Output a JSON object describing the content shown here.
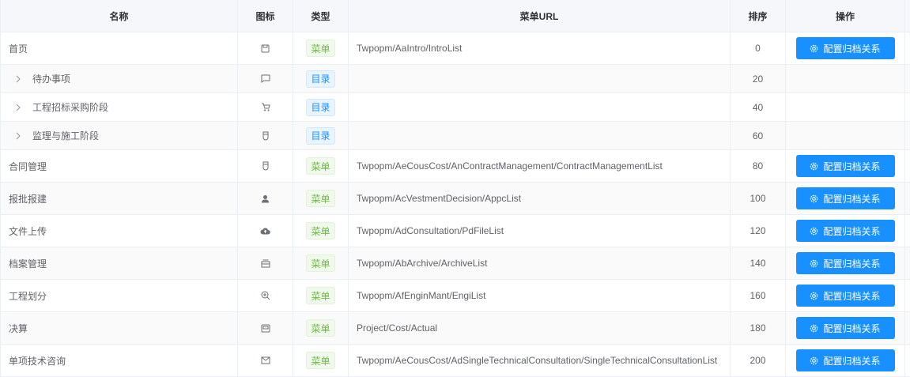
{
  "headers": {
    "name": "名称",
    "icon": "图标",
    "type": "类型",
    "url": "菜单URL",
    "order": "排序",
    "ops": "操作"
  },
  "action_label": "配置归档关系",
  "rows": [
    {
      "name": "首页",
      "icon": "save-icon",
      "type": "菜单",
      "url": "Twpopm/AaIntro/IntroList",
      "order": "0",
      "action": true,
      "child": false
    },
    {
      "name": "待办事项",
      "icon": "message-icon",
      "type": "目录",
      "url": "",
      "order": "20",
      "action": false,
      "child": true
    },
    {
      "name": "工程招标采购阶段",
      "icon": "cart-icon",
      "type": "目录",
      "url": "",
      "order": "40",
      "action": false,
      "child": true
    },
    {
      "name": "监理与施工阶段",
      "icon": "cup-icon",
      "type": "目录",
      "url": "",
      "order": "60",
      "action": false,
      "child": true
    },
    {
      "name": "合同管理",
      "icon": "cup-icon",
      "type": "菜单",
      "url": "Twpopm/AeCousCost/AnContractManagement/ContractManagementList",
      "order": "80",
      "action": true,
      "child": false
    },
    {
      "name": "报批报建",
      "icon": "user-icon",
      "type": "菜单",
      "url": "Twpopm/AcVestmentDecision/AppcList",
      "order": "100",
      "action": true,
      "child": false
    },
    {
      "name": "文件上传",
      "icon": "cloud-upload-icon",
      "type": "菜单",
      "url": "Twpopm/AdConsultation/PdFileList",
      "order": "120",
      "action": true,
      "child": false
    },
    {
      "name": "档案管理",
      "icon": "box-icon",
      "type": "菜单",
      "url": "Twpopm/AbArchive/ArchiveList",
      "order": "140",
      "action": true,
      "child": false
    },
    {
      "name": "工程划分",
      "icon": "zoom-in-icon",
      "type": "菜单",
      "url": "Twpopm/AfEnginMant/EngiList",
      "order": "160",
      "action": true,
      "child": false
    },
    {
      "name": "决算",
      "icon": "calc-icon",
      "type": "菜单",
      "url": "Project/Cost/Actual",
      "order": "180",
      "action": true,
      "child": false
    },
    {
      "name": "单项技术咨询",
      "icon": "mail-icon",
      "type": "菜单",
      "url": "Twpopm/AeCousCost/AdSingleTechnicalConsultation/SingleTechnicalConsultationList",
      "order": "200",
      "action": true,
      "child": false
    }
  ]
}
